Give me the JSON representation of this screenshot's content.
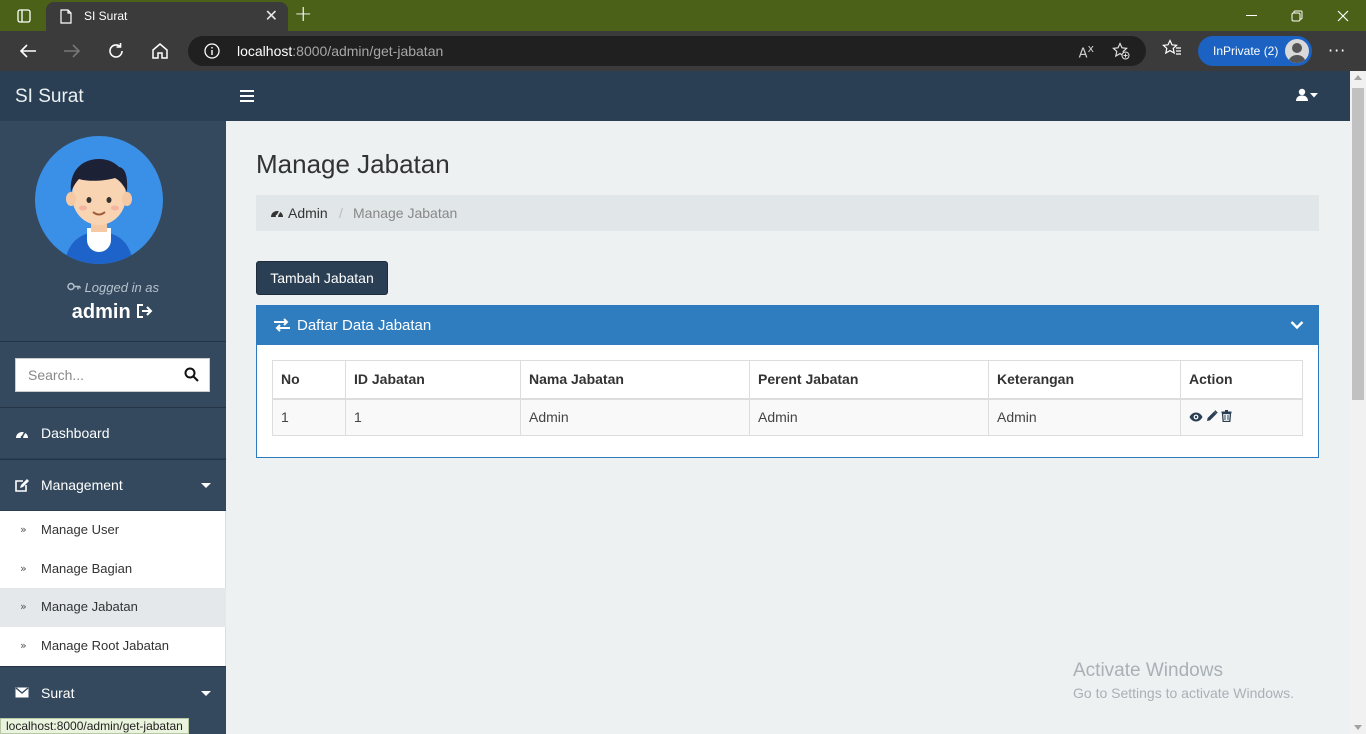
{
  "browser": {
    "tab_title": "SI Surat",
    "url_host": "localhost",
    "url_rest": ":8000/admin/get-jabatan",
    "inprivate_label": "InPrivate (2)",
    "status_url": "localhost:8000/admin/get-jabatan"
  },
  "app": {
    "brand": "SI Surat"
  },
  "profile": {
    "logged_label": "Logged in as",
    "username": "admin"
  },
  "search": {
    "placeholder": "Search..."
  },
  "sidebar": {
    "dashboard": "Dashboard",
    "management": "Management",
    "sub_items": [
      "Manage User",
      "Manage Bagian",
      "Manage Jabatan",
      "Manage Root Jabatan"
    ],
    "surat": "Surat"
  },
  "main": {
    "title": "Manage Jabatan",
    "breadcrumb_home": "Admin",
    "breadcrumb_sep": "/",
    "breadcrumb_current": "Manage Jabatan",
    "add_button": "Tambah Jabatan",
    "panel_title": "Daftar Data Jabatan"
  },
  "table": {
    "headers": [
      "No",
      "ID Jabatan",
      "Nama Jabatan",
      "Perent Jabatan",
      "Keterangan",
      "Action"
    ],
    "rows": [
      [
        "1",
        "1",
        "Admin",
        "Admin",
        "Admin"
      ]
    ]
  },
  "watermark": {
    "line1": "Activate Windows",
    "line2": "Go to Settings to activate Windows."
  },
  "colors": {
    "sidebar": "#2a3f54",
    "panel_header": "#2f7dbe",
    "content_bg": "#edf1f2"
  }
}
